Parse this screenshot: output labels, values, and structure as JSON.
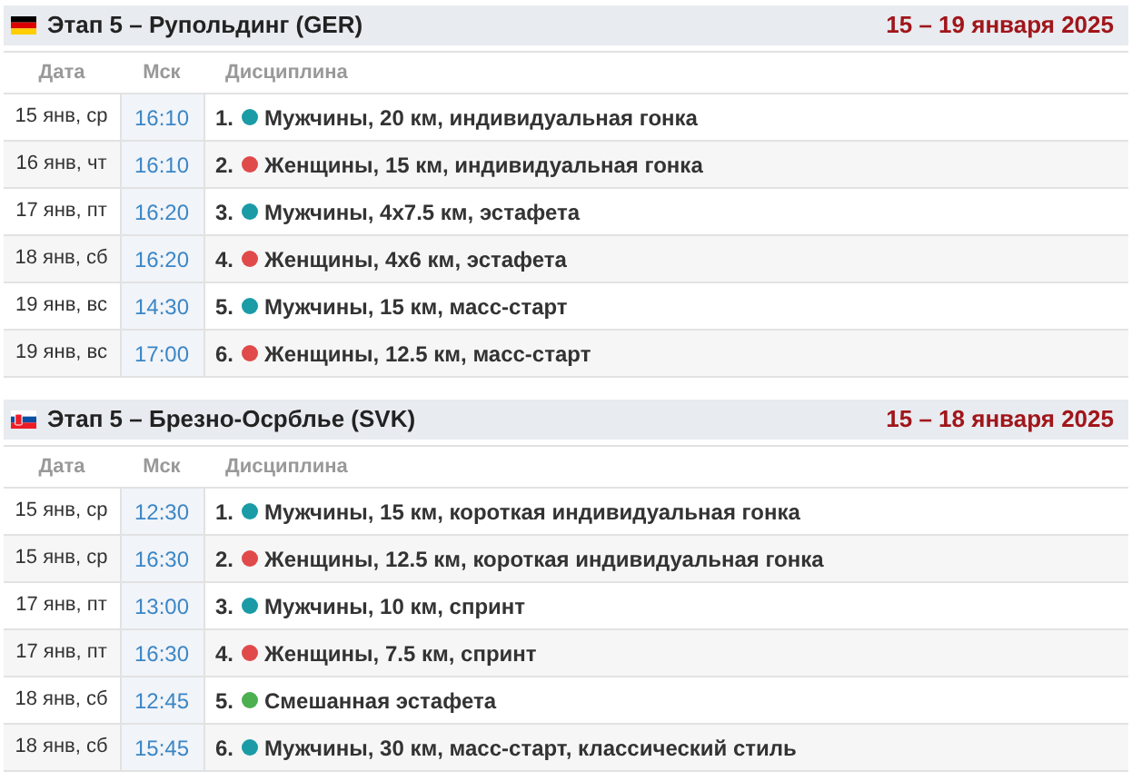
{
  "stages": [
    {
      "kind": "germany",
      "title": "Этап 5 – Рупольдинг (GER)",
      "dates": "15 – 19 января 2025",
      "columns": [
        "Дата",
        "Мск",
        "Дисциплина"
      ],
      "rows": [
        {
          "date": "15 янв, ср",
          "time": "16:10",
          "number": "1.",
          "color": "#1a9ba6",
          "discipline": "Мужчины, 20 км, индивидуальная гонка"
        },
        {
          "date": "16 янв, чт",
          "time": "16:10",
          "number": "2.",
          "color": "#e04a4a",
          "discipline": "Женщины, 15 км, индивидуальная гонка"
        },
        {
          "date": "17 янв, пт",
          "time": "16:20",
          "number": "3.",
          "color": "#1a9ba6",
          "discipline": "Мужчины, 4х7.5 км, эстафета"
        },
        {
          "date": "18 янв, сб",
          "time": "16:20",
          "number": "4.",
          "color": "#e04a4a",
          "discipline": "Женщины, 4х6 км, эстафета"
        },
        {
          "date": "19 янв, вс",
          "time": "14:30",
          "number": "5.",
          "color": "#1a9ba6",
          "discipline": "Мужчины, 15 км, масс-старт"
        },
        {
          "date": "19 янв, вс",
          "time": "17:00",
          "number": "6.",
          "color": "#e04a4a",
          "discipline": "Женщины, 12.5 км, масс-старт"
        }
      ]
    },
    {
      "kind": "slovakia",
      "title": "Этап 5 – Брезно-Осрблье (SVK)",
      "dates": "15 – 18 января 2025",
      "columns": [
        "Дата",
        "Мск",
        "Дисциплина"
      ],
      "rows": [
        {
          "date": "15 янв, ср",
          "time": "12:30",
          "number": "1.",
          "color": "#1a9ba6",
          "discipline": "Мужчины, 15 км, короткая индивидуальная гонка"
        },
        {
          "date": "15 янв, ср",
          "time": "16:30",
          "number": "2.",
          "color": "#e04a4a",
          "discipline": "Женщины, 12.5 км, короткая индивидуальная гонка"
        },
        {
          "date": "17 янв, пт",
          "time": "13:00",
          "number": "3.",
          "color": "#1a9ba6",
          "discipline": "Мужчины, 10 км, спринт"
        },
        {
          "date": "17 янв, пт",
          "time": "16:30",
          "number": "4.",
          "color": "#e04a4a",
          "discipline": "Женщины, 7.5 км, спринт"
        },
        {
          "date": "18 янв, сб",
          "time": "12:45",
          "number": "5.",
          "color": "#4caf50",
          "discipline": "Смешанная эстафета"
        },
        {
          "date": "18 янв, сб",
          "time": "15:45",
          "number": "6.",
          "color": "#1a9ba6",
          "discipline": "Мужчины, 30 км, масс-старт, классический стиль"
        }
      ]
    }
  ]
}
